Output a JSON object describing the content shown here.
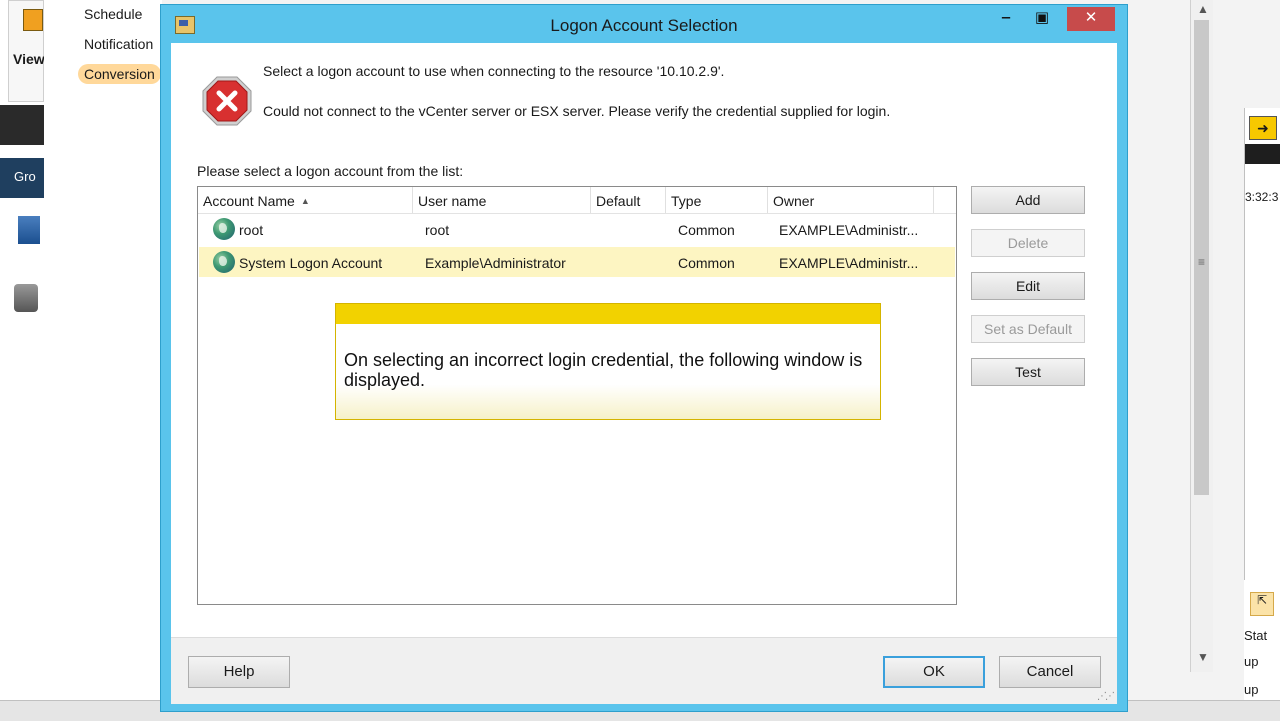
{
  "background": {
    "view_label": "View",
    "group_label": "Gro",
    "nav_items": [
      "Schedule",
      "Notification",
      "Conversion"
    ],
    "time_text": "3:32:3",
    "status_texts": [
      "Stat",
      "up",
      "up"
    ]
  },
  "dialog": {
    "title": "Logon Account Selection",
    "message_select": "Select a logon account to use when connecting to the resource '10.10.2.9'.",
    "message_error": "Could not connect to the vCenter server or ESX server. Please verify the credential supplied for login.",
    "list_caption": "Please select a logon account from the list:",
    "columns": [
      "Account Name",
      "User name",
      "Default",
      "Type",
      "Owner"
    ],
    "rows": [
      {
        "account": "root",
        "user": "root",
        "default": "",
        "type": "Common",
        "owner": "EXAMPLE\\Administr...",
        "selected": false
      },
      {
        "account": "System Logon Account",
        "user": "Example\\Administrator",
        "default": "",
        "type": "Common",
        "owner": "EXAMPLE\\Administr...",
        "selected": true
      }
    ],
    "buttons": {
      "add": "Add",
      "delete": "Delete",
      "edit": "Edit",
      "set_default": "Set as Default",
      "test": "Test",
      "help": "Help",
      "ok": "OK",
      "cancel": "Cancel"
    },
    "callout_text": "On selecting an incorrect login credential, the following window is displayed."
  },
  "colors": {
    "titlebar": "#5ac4ec",
    "close_button": "#c74b4b",
    "selected_row": "#fdf5c2",
    "callout_band": "#f2d200"
  },
  "icons": {
    "error": "error-icon",
    "title": "app-title-icon",
    "account": "globe-icon"
  }
}
